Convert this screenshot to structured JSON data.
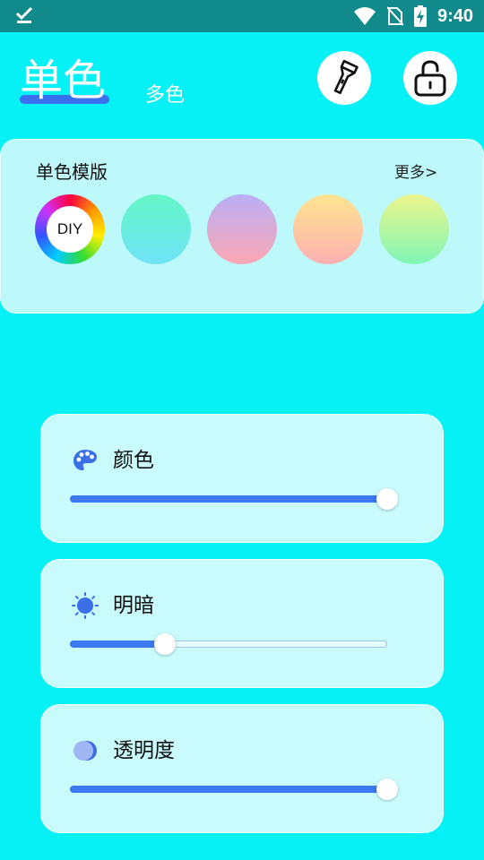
{
  "status_bar": {
    "time": "9:40",
    "left_icon": "download-done-icon",
    "icons": [
      "wifi-icon",
      "no-sim-icon",
      "battery-charging-icon"
    ]
  },
  "header": {
    "tabs": [
      {
        "label": "单色",
        "active": true
      },
      {
        "label": "多色",
        "active": false
      }
    ],
    "buttons": [
      {
        "icon": "flashlight-icon"
      },
      {
        "icon": "lock-icon"
      }
    ]
  },
  "templates": {
    "title": "单色模版",
    "more_label": "更多>",
    "diy_label": "DIY",
    "swatches": [
      {
        "top": "#63f7c6",
        "bottom": "#70e3f6"
      },
      {
        "top": "#b9aef5",
        "bottom": "#fca8b4"
      },
      {
        "top": "#fee591",
        "bottom": "#fdb0b0"
      },
      {
        "top": "#edf58c",
        "bottom": "#7ff6b6"
      }
    ]
  },
  "sliders": [
    {
      "label": "颜色",
      "icon": "palette-icon",
      "value": 1.0
    },
    {
      "label": "明暗",
      "icon": "sun-icon",
      "value": 0.3
    },
    {
      "label": "透明度",
      "icon": "opacity-icon",
      "value": 1.0
    }
  ],
  "colors": {
    "background": "#06f1f5",
    "accent": "#3b78f2",
    "status_bar": "#118a8c"
  }
}
